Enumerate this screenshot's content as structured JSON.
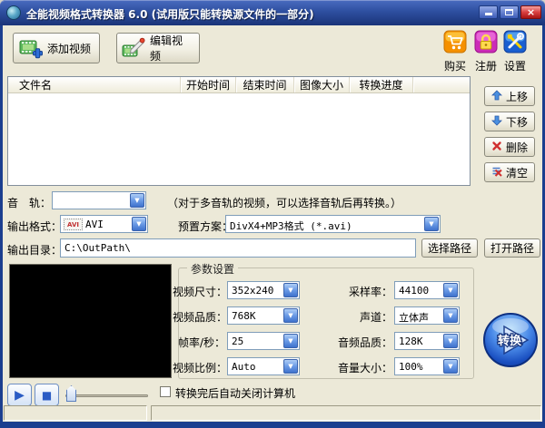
{
  "window": {
    "title": "全能视频格式转换器 6.0 (试用版只能转换源文件的一部分)",
    "close_glyph": "×"
  },
  "toolbar": {
    "add_video": "添加视频",
    "edit_video": "编辑视频",
    "buy": "购买",
    "register": "注册",
    "settings": "设置"
  },
  "file_list": {
    "columns": [
      "文件名",
      "开始时间",
      "结束时间",
      "图像大小",
      "转换进度"
    ],
    "rows": []
  },
  "list_actions": {
    "move_up": "上移",
    "move_down": "下移",
    "delete": "删除",
    "clear": "清空"
  },
  "audio_track": {
    "label": "音　轨：",
    "value": "",
    "note": "（对于多音轨的视频，可以选择音轨后再转换。）"
  },
  "output": {
    "format_label": "输出格式：",
    "format_icon": "AVI",
    "format_value": "AVI",
    "preset_label": "预置方案：",
    "preset_value": "DivX4+MP3格式 (*.avi)",
    "dir_label": "输出目录：",
    "dir_value": "C:\\OutPath\\",
    "select_path": "选择路径",
    "open_path": "打开路径"
  },
  "params": {
    "title": "参数设置",
    "fields": [
      {
        "label": "视频尺寸：",
        "value": "352x240"
      },
      {
        "label": "采样率：",
        "value": "44100"
      },
      {
        "label": "视频品质：",
        "value": "768K"
      },
      {
        "label": "声道：",
        "value": "立体声"
      },
      {
        "label": "帧率/秒：",
        "value": "25"
      },
      {
        "label": "音频品质：",
        "value": "128K"
      },
      {
        "label": "视频比例：",
        "value": "Auto"
      },
      {
        "label": "音量大小：",
        "value": "100%"
      }
    ]
  },
  "convert": {
    "label": "转换"
  },
  "options": {
    "shutdown_label": "转换完后自动关闭计算机",
    "shutdown_checked": false
  },
  "icons": {
    "chevron_down": "▼",
    "play": "▶",
    "stop": "■"
  },
  "colors": {
    "titlebar_top": "#4a6cc0",
    "titlebar_bottom": "#1a3478",
    "window_border": "#1b3e8f",
    "client_bg": "#ece9d8",
    "combo_border": "#7f9db9",
    "accent_blue": "#3f72cc"
  }
}
